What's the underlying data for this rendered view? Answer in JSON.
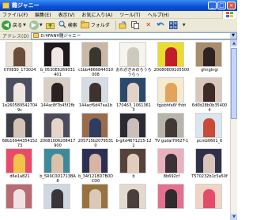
{
  "window": {
    "title": "雛ジャニー",
    "buttons": {
      "minimize": "_",
      "maximize": "□",
      "close": "×"
    }
  },
  "menu": [
    "ファイル(F)",
    "編集(E)",
    "表示(V)",
    "お気に入り(A)",
    "ツール(T)",
    "ヘルプ(H)"
  ],
  "toolbar": {
    "back_label": "戻る",
    "search_label": "検索",
    "folders_label": "フォルダ"
  },
  "address": {
    "label": "アドレス(D)",
    "value": "D:¥FAN¥雛ジャニー"
  },
  "files": [
    {
      "name": "070830_173024",
      "colors": [
        "#e9e0d6",
        "#6b4d3a"
      ]
    },
    {
      "name": "b_0530E6269031401",
      "colors": [
        "#1e1a1c",
        "#f0e8e4"
      ]
    },
    {
      "name": "c1bb4866844310008",
      "colors": [
        "#c9b8a6",
        "#3c3530"
      ]
    },
    {
      "name": "おれがきみのろうろうらっ",
      "colors": [
        "#f6f4ef",
        "#cfc8bd"
      ]
    },
    {
      "name": "20080809105500",
      "colors": [
        "#e8dd2c",
        "#c21d2a"
      ]
    },
    {
      "name": "ghnglngi",
      "colors": [
        "#a88c6e",
        "#2d2420"
      ]
    },
    {
      "name": "1e2605895427049c",
      "colors": [
        "#4c4f62",
        "#efe7df"
      ]
    },
    {
      "name": "144ac8f7b45f2fb",
      "colors": [
        "#d9cfc7",
        "#2a2220"
      ]
    },
    {
      "name": "144acf6d47aa1b",
      "colors": [
        "#d7dbe3",
        "#3e3231"
      ]
    },
    {
      "name": "170463_10613613",
      "colors": [
        "#2b4a6b",
        "#e2d3c6"
      ]
    },
    {
      "name": "fgjsbhfa6f fhbt",
      "colors": [
        "#f6ead0",
        "#e2a35c"
      ]
    },
    {
      "name": "6d0b28b0b354004",
      "colors": [
        "#d8c8bb",
        "#3c2b26"
      ]
    },
    {
      "name": "68b1694435415273",
      "colors": [
        "#3b3e47",
        "#d5c3b6"
      ]
    },
    {
      "name": "20081006208417900",
      "colors": [
        "#4c4b5a",
        "#e6d4c9"
      ]
    },
    {
      "name": "205715b20795310",
      "colors": [
        "#9a6b4c",
        "#2f3c62"
      ]
    },
    {
      "name": "b-gitd4671215-122",
      "colors": [
        "#2b2a35",
        "#cbbfb9"
      ]
    },
    {
      "name": "TV gudal7062T-1",
      "colors": [
        "#b7b4a9",
        "#423937"
      ]
    },
    {
      "name": "pcmb0601_6",
      "colors": [
        "#d9e6ee",
        "#c84a38"
      ]
    },
    {
      "name": "d6e1a821",
      "colors": [
        "#e84b69",
        "#f3c24b"
      ]
    },
    {
      "name": "b_5R9C0D1713BA8",
      "colors": [
        "#3e8a9a",
        "#dac1a8"
      ]
    },
    {
      "name": "b_34f1218D7B0DCD0",
      "colors": [
        "#2b2f54",
        "#d7b4a4"
      ]
    },
    {
      "name": "b",
      "colors": [
        "#55423b",
        "#e2cdbc"
      ]
    },
    {
      "name": "8b692cf",
      "colors": [
        "#e8b2bd",
        "#3a3236"
      ]
    },
    {
      "name": "T570232b1c5a50f",
      "colors": [
        "#30304a",
        "#d8c5ba"
      ]
    },
    {
      "name": "",
      "colors": [
        "#b76b73",
        "#f1e1e3"
      ]
    },
    {
      "name": "",
      "colors": [
        "#cfd8e0",
        "#3a3538"
      ]
    },
    {
      "name": "",
      "colors": [
        "#98733f",
        "#d9c9b6"
      ]
    },
    {
      "name": "",
      "colors": [
        "#e3d9cf",
        "#4a3f3c"
      ]
    },
    {
      "name": "",
      "colors": [
        "#e56f8f",
        "#2f2b2d"
      ]
    },
    {
      "name": "",
      "colors": [
        "#f2d4c6",
        "#e34c68"
      ]
    }
  ]
}
